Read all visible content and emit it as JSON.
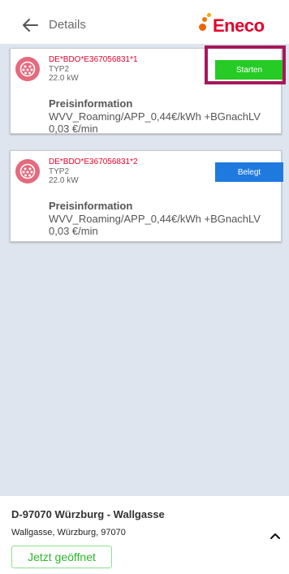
{
  "header": {
    "title": "Details",
    "brand": "Eneco"
  },
  "connectors": [
    {
      "id": "DE*BDO*E367056831*1",
      "type": "TYP2",
      "power": "22.0 kW",
      "status_label": "Starten",
      "status_color": "#26cb26",
      "price_heading": "Preisinformation",
      "price_line1": "WVV_Roaming/APP_0,44€/kWh +BGnachLV",
      "price_line2": "0,03 €/min"
    },
    {
      "id": "DE*BDO*E367056831*2",
      "type": "TYP2",
      "power": "22.0 kW",
      "status_label": "Belegt",
      "status_color": "#1f7ae0",
      "price_heading": "Preisinformation",
      "price_line1": "WVV_Roaming/APP_0,44€/kWh +BGnachLV",
      "price_line2": "0,03 €/min"
    }
  ],
  "footer": {
    "station_title": "D-97070 Würzburg - Wallgasse",
    "address": "Wallgasse, Würzburg, 97070",
    "open_label": "Jetzt geöffnet"
  },
  "colors": {
    "brand_red": "#e4002b",
    "highlight": "#a6185a",
    "map_background": "#dfe5ee"
  }
}
